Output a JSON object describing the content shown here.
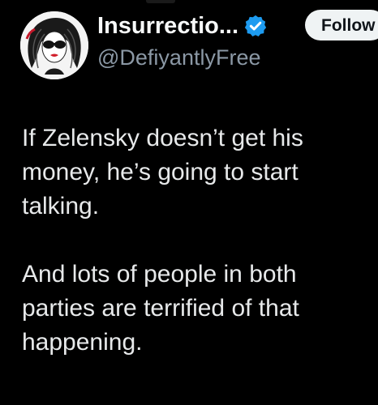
{
  "author": {
    "display_name": "Insurrectio...",
    "handle": "@DefiyantlyFree",
    "avatar_icon": "profile-avatar",
    "verified_icon": "verified-badge-icon",
    "verified_color": "#1d9bf0"
  },
  "actions": {
    "follow_label": "Follow"
  },
  "tweet": {
    "paragraph_1": "If Zelensky doesn’t get his money, he’s going to start talking.",
    "paragraph_2": "And lots of people in both parties are terrified of that happening."
  },
  "colors": {
    "background": "#000000",
    "text_primary": "#e7e9ea",
    "text_secondary": "#8b98a5",
    "button_bg": "#eff3f4"
  }
}
